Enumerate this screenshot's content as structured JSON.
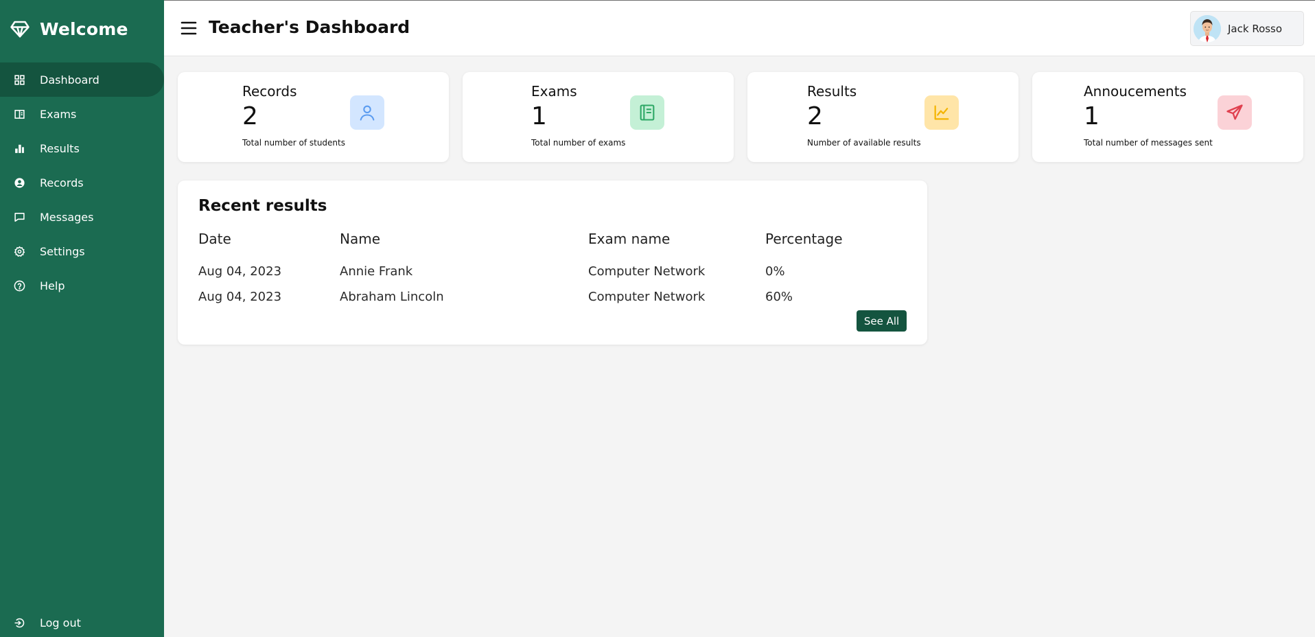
{
  "sidebar": {
    "brand": "Welcome",
    "items": [
      {
        "label": "Dashboard",
        "icon": "grid-icon"
      },
      {
        "label": "Exams",
        "icon": "book-open-icon"
      },
      {
        "label": "Results",
        "icon": "bar-chart-icon"
      },
      {
        "label": "Records",
        "icon": "user-circle-icon"
      },
      {
        "label": "Messages",
        "icon": "message-icon"
      },
      {
        "label": "Settings",
        "icon": "gear-icon"
      },
      {
        "label": "Help",
        "icon": "help-circle-icon"
      }
    ],
    "active_item": "Dashboard",
    "logout_label": "Log out"
  },
  "header": {
    "title": "Teacher's Dashboard",
    "user_name": "Jack Rosso"
  },
  "cards": [
    {
      "label": "Records",
      "value": "2",
      "description": "Total number of students",
      "icon": "user-icon",
      "icon_bg": "#d3e6ff",
      "icon_color": "#5b9cf0"
    },
    {
      "label": "Exams",
      "value": "1",
      "description": "Total number of exams",
      "icon": "book-icon",
      "icon_bg": "#c4f0d6",
      "icon_color": "#2ea866"
    },
    {
      "label": "Results",
      "value": "2",
      "description": "Number of available results",
      "icon": "line-chart-icon",
      "icon_bg": "#ffe5a8",
      "icon_color": "#f4b400"
    },
    {
      "label": "Annoucements",
      "value": "1",
      "description": "Total number of messages sent",
      "icon": "send-icon",
      "icon_bg": "#fbd2d7",
      "icon_color": "#e0404f"
    }
  ],
  "recent_results": {
    "title": "Recent results",
    "columns": [
      "Date",
      "Name",
      "Exam name",
      "Percentage"
    ],
    "rows": [
      [
        "Aug 04, 2023",
        "Annie Frank",
        "Computer Network",
        "0%"
      ],
      [
        "Aug 04, 2023",
        "Abraham Lincoln",
        "Computer Network",
        "60%"
      ]
    ],
    "see_all_label": "See All"
  },
  "colors": {
    "sidebar_bg": "#1b6b51",
    "active_bg": "#14543f",
    "button_bg": "#14543f",
    "page_bg": "#f4f4f4"
  }
}
